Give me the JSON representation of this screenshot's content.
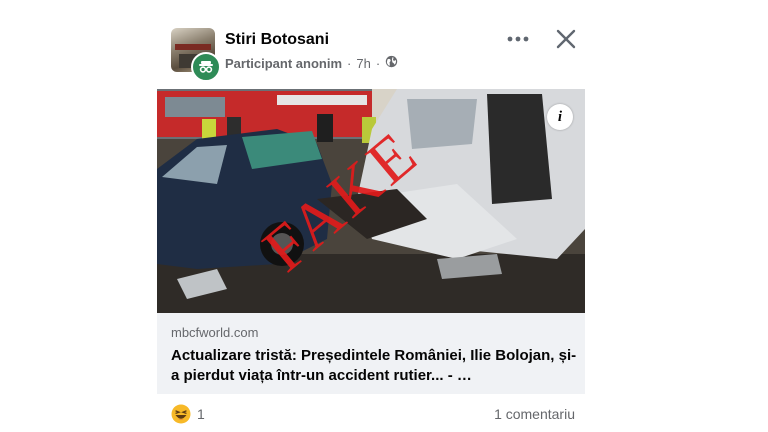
{
  "post": {
    "page_name": "Stiri Botosani",
    "role": "Participant anonim",
    "time": "7h",
    "separator": "·",
    "privacy_icon": "globe-icon",
    "more_icon": "more-dots-icon",
    "close_icon": "close-icon"
  },
  "image": {
    "stamp_text": "FAKE",
    "stamp_color": "#e11b1b",
    "info_label": "i"
  },
  "link": {
    "domain": "mbcfworld.com",
    "headline": "Actualizare tristă: Președintele României, Ilie Bolojan, și-a pierdut viața într-un accident rutier... - …"
  },
  "footer": {
    "reaction_icon": "haha-emoji-icon",
    "reaction_count": "1",
    "comments": "1 comentariu"
  }
}
